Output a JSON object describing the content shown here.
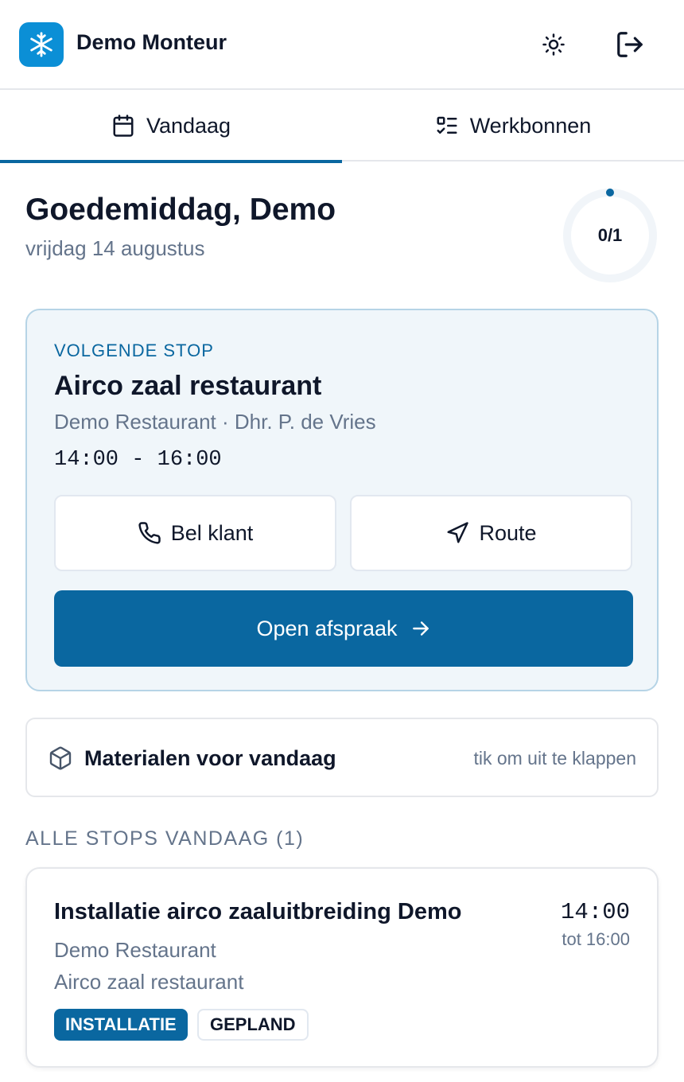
{
  "header": {
    "app_name": "Demo Monteur",
    "logo_icon": "snowflake-icon",
    "theme_icon": "sun-icon",
    "logout_icon": "logout-icon"
  },
  "tabs": [
    {
      "label": "Vandaag",
      "icon": "calendar-icon",
      "active": true
    },
    {
      "label": "Werkbonnen",
      "icon": "checklist-icon",
      "active": false
    }
  ],
  "greeting": {
    "title": "Goedemiddag, Demo",
    "date": "vrijdag 14 augustus"
  },
  "progress": {
    "label": "0/1",
    "completed": 0,
    "total": 1
  },
  "next_stop": {
    "eyebrow": "VOLGENDE STOP",
    "title": "Airco zaal restaurant",
    "subtitle": "Demo Restaurant · Dhr. P. de Vries",
    "time": "14:00 - 16:00",
    "call_label": "Bel klant",
    "route_label": "Route",
    "open_label": "Open afspraak"
  },
  "materials": {
    "label": "Materialen voor vandaag",
    "hint": "tik om uit te klappen"
  },
  "stops": {
    "heading": "ALLE STOPS VANDAAG (1)",
    "items": [
      {
        "title": "Installatie airco zaaluitbreiding Demo",
        "client": "Demo Restaurant",
        "description": "Airco zaal restaurant",
        "start": "14:00",
        "until": "tot 16:00",
        "type_badge": "INSTALLATIE",
        "status_badge": "GEPLAND"
      }
    ]
  },
  "colors": {
    "primary": "#0a67a0",
    "logo_bg": "#0b8fd6",
    "card_bg": "#f0f6fa",
    "muted_text": "#64748b"
  }
}
